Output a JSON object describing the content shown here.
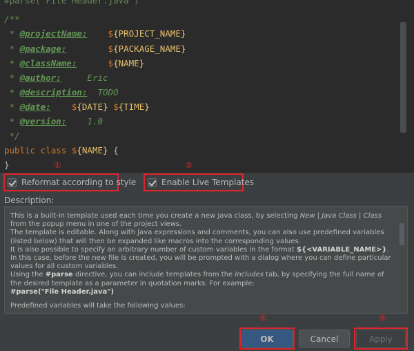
{
  "editor": {
    "line0": "#parse(\"File Header.java\")",
    "line1": "/**",
    "line2": {
      "prefix": " * ",
      "tag": "@projectName:",
      "space": "    ",
      "dollar": "$",
      "lbrace": "{",
      "var": "PROJECT_NAME",
      "rbrace": "}"
    },
    "line3": {
      "prefix": " * ",
      "tag": "@package:",
      "space": "        ",
      "dollar": "$",
      "lbrace": "{",
      "var": "PACKAGE_NAME",
      "rbrace": "}"
    },
    "line4": {
      "prefix": " * ",
      "tag": "@className:",
      "space": "      ",
      "dollar": "$",
      "lbrace": "{",
      "var": "NAME",
      "rbrace": "}"
    },
    "line5": {
      "prefix": " * ",
      "tag": "@author:",
      "text": "     Eric"
    },
    "line6": {
      "prefix": " * ",
      "tag": "@description:",
      "text": "  TODO"
    },
    "line7": {
      "prefix": " * ",
      "tag": "@date:",
      "space": "    ",
      "dollar": "$",
      "lbrace": "{",
      "var": "DATE",
      "rbrace": "}",
      "dollar2": "$",
      "lbrace2": "{",
      "var2": "TIME",
      "rbrace2": "}"
    },
    "line8": {
      "prefix": " * ",
      "tag": "@version:",
      "text": "    1.0"
    },
    "line9": " */",
    "line10": {
      "kw": "public class ",
      "dollar": "$",
      "lbrace": "{",
      "var": "NAME",
      "rbrace": "}",
      "tail": " {"
    },
    "line11": "}"
  },
  "options": {
    "reformat_label": "Reformat according to style",
    "live_templates_label": "Enable Live Templates",
    "reformat_checked": true,
    "live_templates_checked": true
  },
  "annotations": {
    "n1": "①",
    "n2": "②",
    "n3": "③",
    "n4": "④"
  },
  "description": {
    "label": "Description:",
    "p1a": "This is a built-in template used each time you create a new Java class, by selecting ",
    "p1b": "New",
    "p1c": " | ",
    "p1d": "Java Class",
    "p1e": " | ",
    "p1f": "Class",
    "p1g": " from the popup menu in one of the project views.",
    "p2": "The template is editable. Along with Java expressions and comments, you can also use predefined variables (listed below) that will then be expanded like macros into the corresponding values.",
    "p3a": "It is also possible to specify an arbitrary number of custom variables in the format ",
    "p3b": "${<VARIABLE_NAME>}",
    "p3c": ". In this case, before the new file is created, you will be prompted with a dialog where you can define particular values for all custom variables.",
    "p4a": "Using the ",
    "p4b": "#parse",
    "p4c": " directive, you can include templates from the ",
    "p4d": "Includes",
    "p4e": " tab, by specifying the full name of the desired template as a parameter in quotation marks. For example:",
    "p5": "#parse(\"File Header.java\")",
    "p6": "Predefined variables will take the following values:"
  },
  "buttons": {
    "ok": "OK",
    "cancel": "Cancel",
    "apply": "Apply"
  }
}
